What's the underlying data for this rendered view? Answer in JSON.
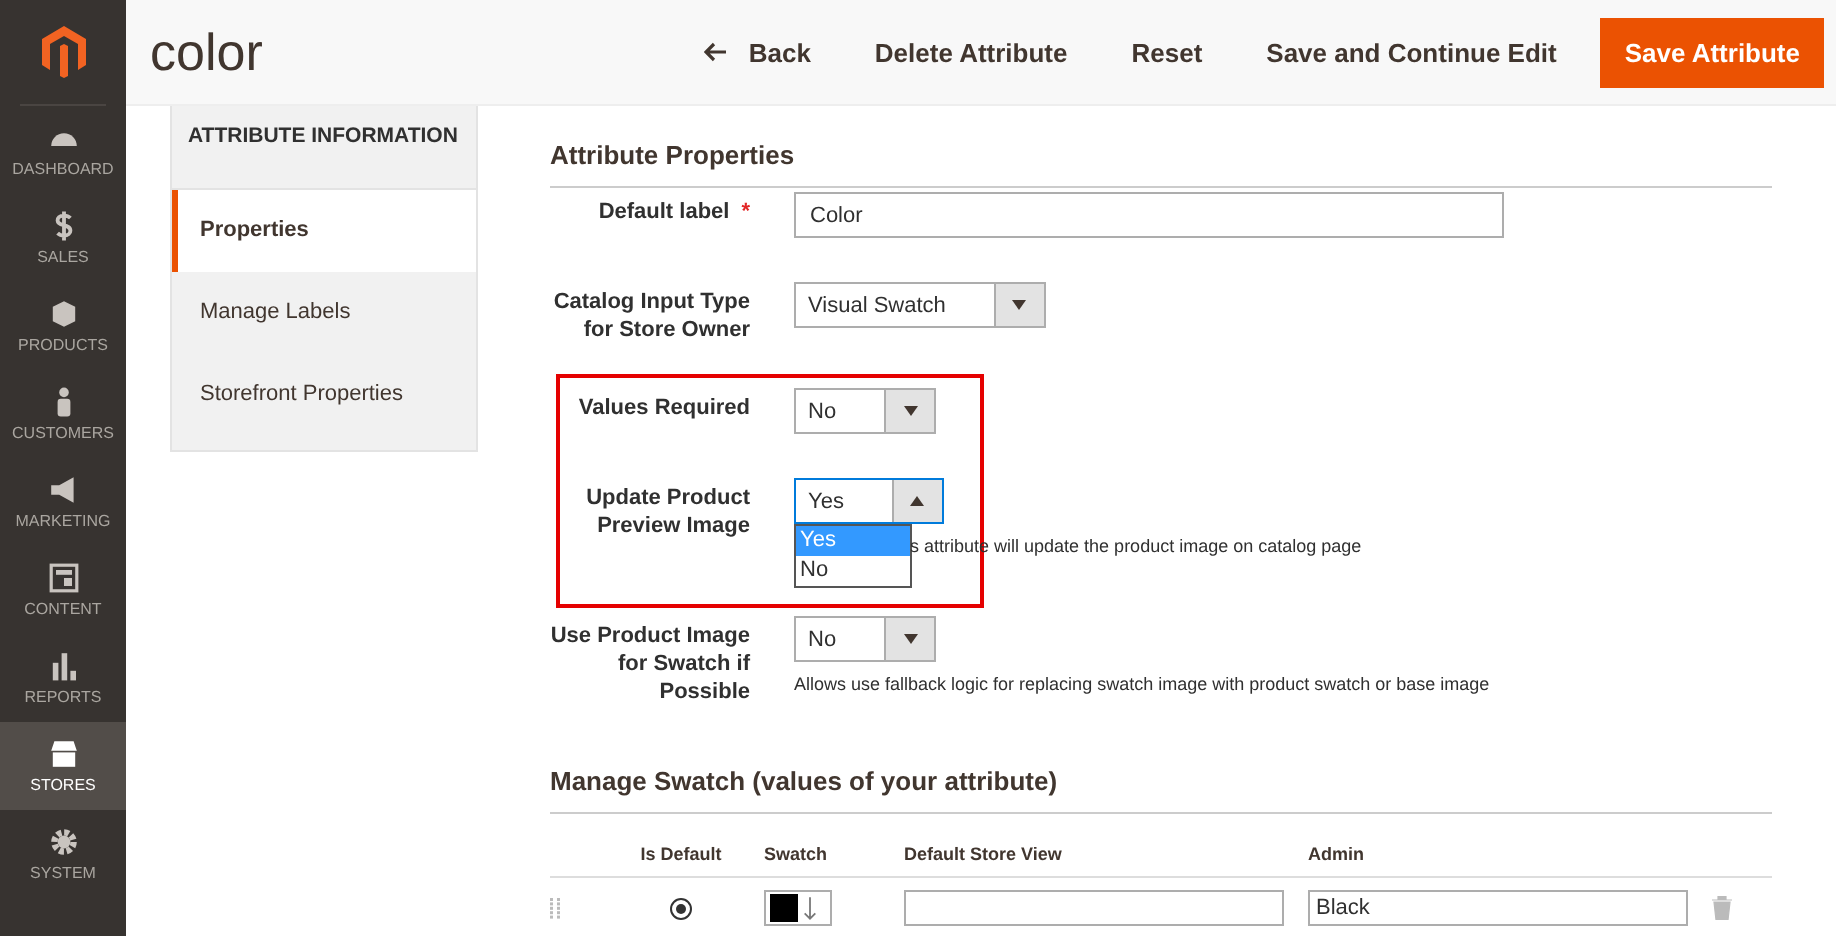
{
  "header": {
    "title": "color",
    "actions": [
      {
        "label": "Back",
        "kind": "back"
      },
      {
        "label": "Delete Attribute",
        "kind": "link"
      },
      {
        "label": "Reset",
        "kind": "link"
      },
      {
        "label": "Save and Continue Edit",
        "kind": "link"
      },
      {
        "label": "Save Attribute",
        "kind": "primary"
      }
    ]
  },
  "nav": [
    {
      "label": "DASHBOARD",
      "selected": false
    },
    {
      "label": "SALES",
      "selected": false
    },
    {
      "label": "PRODUCTS",
      "selected": false
    },
    {
      "label": "CUSTOMERS",
      "selected": false
    },
    {
      "label": "MARKETING",
      "selected": false
    },
    {
      "label": "CONTENT",
      "selected": false
    },
    {
      "label": "REPORTS",
      "selected": false
    },
    {
      "label": "STORES",
      "selected": true
    },
    {
      "label": "SYSTEM",
      "selected": false
    }
  ],
  "tabs": {
    "title": "ATTRIBUTE INFORMATION",
    "items": [
      {
        "label": "Properties",
        "selected": true
      },
      {
        "label": "Manage Labels",
        "selected": false
      },
      {
        "label": "Storefront Properties",
        "selected": false
      }
    ]
  },
  "properties": {
    "title": "Attribute Properties",
    "fields": [
      {
        "label": "Default label",
        "kind": "text",
        "required_mark": "*",
        "value": "Color"
      },
      {
        "label": "Catalog Input Type for Store Owner",
        "kind": "select",
        "expanded": false,
        "value": "Visual Swatch"
      },
      {
        "label": "Values Required",
        "kind": "select",
        "expanded": false,
        "value": "No"
      },
      {
        "label": "Update Product Preview Image",
        "kind": "select",
        "expanded": true,
        "value": "Yes",
        "options": [
          {
            "label": "Yes",
            "selected": true
          },
          {
            "label": "No",
            "selected": false
          }
        ],
        "note": "s attribute will update the product image on catalog page"
      },
      {
        "label": "Use Product Image for Swatch if Possible",
        "kind": "select",
        "expanded": false,
        "value": "No",
        "note": "Allows use fallback logic for replacing swatch image with product swatch or base image"
      }
    ]
  },
  "swatch": {
    "title": "Manage Swatch (values of your attribute)",
    "columns": [
      "Is Default",
      "Swatch",
      "Default Store View",
      "Admin"
    ],
    "rows": [
      {
        "selected": true,
        "color": "#000000",
        "admin": "Black"
      }
    ]
  }
}
